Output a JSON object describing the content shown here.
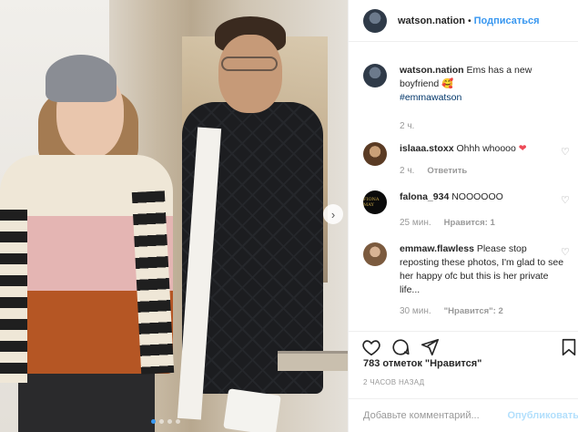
{
  "post": {
    "author": "watson.nation",
    "follow_label": "Подписаться",
    "separator": "•"
  },
  "caption": {
    "user": "watson.nation",
    "text": "Ems has a new boyfriend",
    "emoji": "🥰",
    "hashtag": "#emmawatson",
    "time": "2 ч."
  },
  "comments": [
    {
      "user": "islaaa.stoxx",
      "text": "Ohhh whoooo",
      "emoji": "❤",
      "time": "2 ч.",
      "action": "Ответить"
    },
    {
      "user": "falona_934",
      "text": "NOOOOOO",
      "time": "25 мин.",
      "action": "Нравится: 1",
      "avatar_text": "FIONA MAY"
    },
    {
      "user": "emmaw.flawless",
      "text": "Please stop reposting these photos, I'm glad to see her happy ofc but this is her private life...",
      "time": "30 мин.",
      "action": "\"Нравится\": 2"
    }
  ],
  "likes_text": "783 отметок \"Нравится\"",
  "time_ago": "2 часов назад",
  "add_comment": {
    "placeholder": "Добавьте комментарий...",
    "post_label": "Опубликовать"
  },
  "icons": [
    "heart-icon",
    "comment-icon",
    "share-icon",
    "bookmark-icon",
    "next-arrow-icon"
  ],
  "colors": {
    "link_blue": "#3897f0",
    "hashtag": "#003569",
    "muted": "#999999",
    "post_disabled": "#b2dffc",
    "heart_red": "#ed4956"
  }
}
